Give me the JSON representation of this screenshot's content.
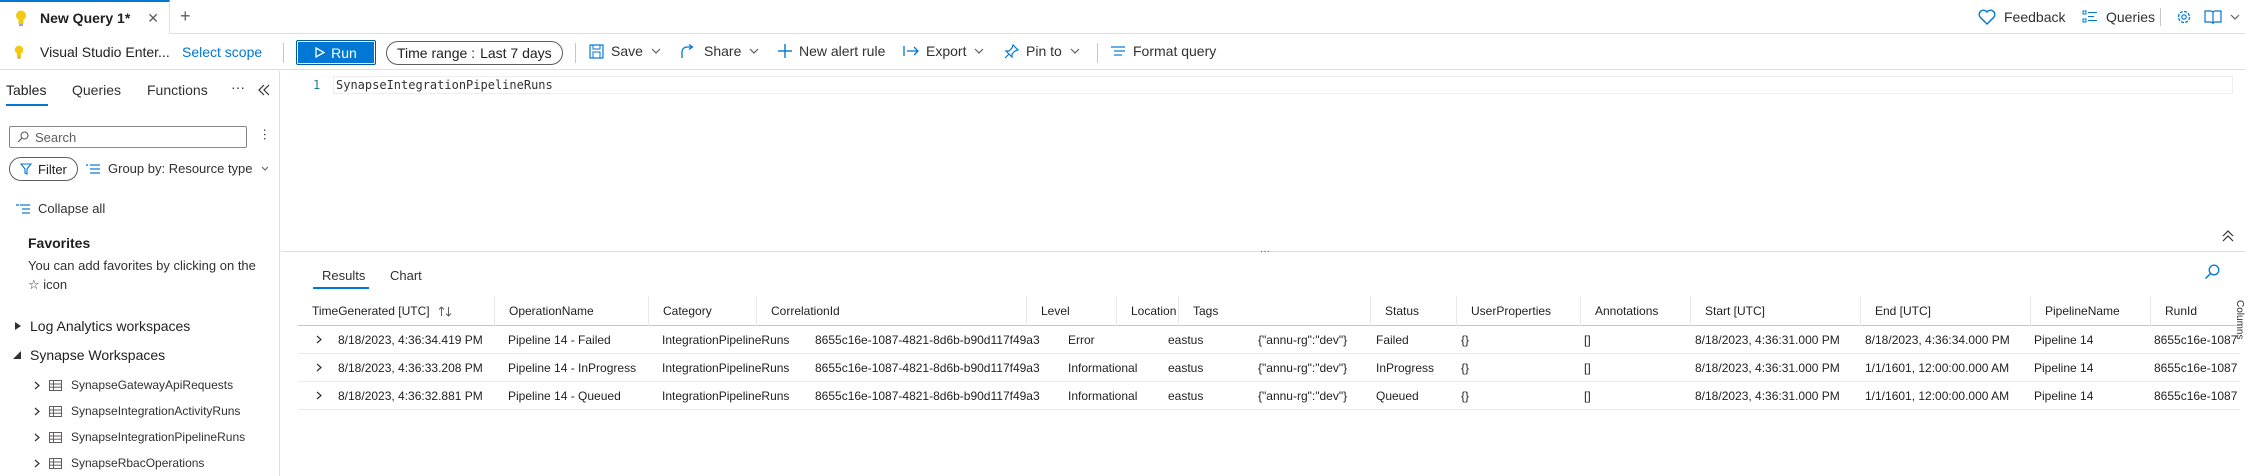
{
  "tabs": [
    {
      "label": "New Query 1*"
    }
  ],
  "top_right": {
    "feedback_label": "Feedback",
    "queries_label": "Queries"
  },
  "toolbar": {
    "scope_name": "Visual Studio Enter...",
    "select_scope_label": "Select scope",
    "run_label": "Run",
    "time_range_label": "Time range :",
    "time_range_value": "Last 7 days",
    "save_label": "Save",
    "share_label": "Share",
    "new_alert_label": "New alert rule",
    "export_label": "Export",
    "pin_label": "Pin to",
    "format_label": "Format query"
  },
  "left_panel": {
    "tabs": [
      "Tables",
      "Queries",
      "Functions"
    ],
    "more_label": "···",
    "search_placeholder": "Search",
    "filter_label": "Filter",
    "group_by_label": "Group by: Resource type",
    "collapse_all_label": "Collapse all",
    "favorites_title": "Favorites",
    "favorites_text": "You can add favorites by clicking on the ☆ icon",
    "groups": [
      {
        "label": "Log Analytics workspaces",
        "expanded": false
      },
      {
        "label": "Synapse Workspaces",
        "expanded": true
      }
    ],
    "tables": [
      "SynapseGatewayApiRequests",
      "SynapseIntegrationActivityRuns",
      "SynapseIntegrationPipelineRuns",
      "SynapseRbacOperations"
    ]
  },
  "editor": {
    "line_number": "1",
    "query": "SynapseIntegrationPipelineRuns"
  },
  "results": {
    "tabs": [
      "Results",
      "Chart"
    ],
    "columns_label": "Columns",
    "columns": [
      "TimeGenerated [UTC]",
      "OperationName",
      "Category",
      "CorrelationId",
      "Level",
      "Location",
      "Tags",
      "Status",
      "UserProperties",
      "Annotations",
      "Start [UTC]",
      "End [UTC]",
      "PipelineName",
      "RunId"
    ],
    "rows": [
      [
        "8/18/2023, 4:36:34.419 PM",
        "Pipeline 14 - Failed",
        "IntegrationPipelineRuns",
        "8655c16e-1087-4821-8d6b-b90d117f49a3",
        "Error",
        "eastus",
        "{\"annu-rg\":\"dev\"}",
        "Failed",
        "{}",
        "[]",
        "8/18/2023, 4:36:31.000 PM",
        "8/18/2023, 4:36:34.000 PM",
        "Pipeline 14",
        "8655c16e-1087"
      ],
      [
        "8/18/2023, 4:36:33.208 PM",
        "Pipeline 14 - InProgress",
        "IntegrationPipelineRuns",
        "8655c16e-1087-4821-8d6b-b90d117f49a3",
        "Informational",
        "eastus",
        "{\"annu-rg\":\"dev\"}",
        "InProgress",
        "{}",
        "[]",
        "8/18/2023, 4:36:31.000 PM",
        "1/1/1601, 12:00:00.000 AM",
        "Pipeline 14",
        "8655c16e-1087"
      ],
      [
        "8/18/2023, 4:36:32.881 PM",
        "Pipeline 14 - Queued",
        "IntegrationPipelineRuns",
        "8655c16e-1087-4821-8d6b-b90d117f49a3",
        "Informational",
        "eastus",
        "{\"annu-rg\":\"dev\"}",
        "Queued",
        "{}",
        "[]",
        "8/18/2023, 4:36:31.000 PM",
        "1/1/1601, 12:00:00.000 AM",
        "Pipeline 14",
        "8655c16e-1087"
      ]
    ]
  },
  "colors": {
    "accent": "#0078d4",
    "bulb": "#f2c811",
    "text": "#323130"
  },
  "icons": [
    "lightbulb-icon",
    "close-icon",
    "plus-icon",
    "heart-icon",
    "queries-icon",
    "gear-icon",
    "book-icon",
    "play-icon",
    "save-icon",
    "share-icon",
    "chevron-down-icon",
    "export-icon",
    "pin-icon",
    "format-icon",
    "double-chevron-left-icon",
    "search-icon",
    "filter-icon",
    "group-icon",
    "collapse-icon",
    "table-icon",
    "expand-chevron-icon",
    "sort-icon"
  ]
}
